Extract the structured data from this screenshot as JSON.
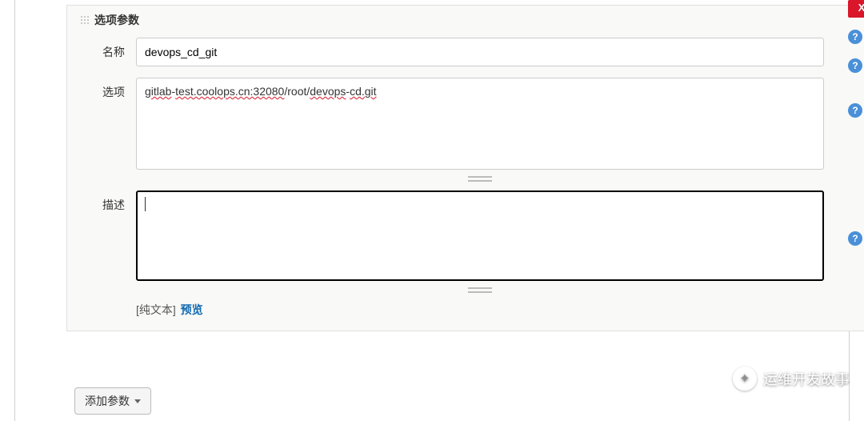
{
  "section": {
    "title": "选项参数"
  },
  "close": {
    "label": "X"
  },
  "fields": {
    "name": {
      "label": "名称",
      "value": "devops_cd_git"
    },
    "options": {
      "label": "选项",
      "value": "gitlab-test.coolops.cn:32080/root/devops-cd.git",
      "parts": {
        "p1": "gitlab",
        "p2": "-",
        "p3": "test.coolops.cn:32080",
        "p4": "/root/",
        "p5": "devops",
        "p6": "-",
        "p7": "cd.git"
      }
    },
    "description": {
      "label": "描述",
      "value": ""
    }
  },
  "mode": {
    "plain": "[纯文本]",
    "preview": "预览"
  },
  "help": {
    "tooltip": "?"
  },
  "addParam": {
    "label": "添加参数"
  },
  "watermark": {
    "text": "运维开发故事"
  }
}
